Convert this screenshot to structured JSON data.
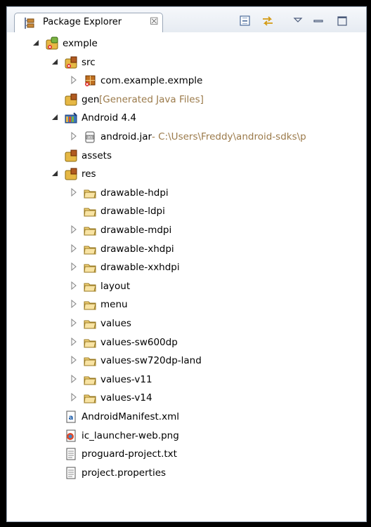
{
  "view": {
    "title": "Package Explorer",
    "close_glyph": "☒",
    "icons": {
      "view_icon": "package-explorer-icon",
      "collapse_all": "collapse-all-icon",
      "link_with_editor": "link-with-editor-icon",
      "view_menu": "view-menu-icon",
      "minimize": "minimize-icon",
      "maximize": "maximize-icon"
    }
  },
  "tree": [
    {
      "label": "exmple",
      "decoration": "",
      "depth": 0,
      "twisty": "expanded",
      "icon": "android-project"
    },
    {
      "label": "src",
      "decoration": "",
      "depth": 1,
      "twisty": "expanded",
      "icon": "source-folder-error"
    },
    {
      "label": "com.example.exmple",
      "decoration": "",
      "depth": 2,
      "twisty": "collapsed",
      "icon": "package-error"
    },
    {
      "label": "gen",
      "decoration": " [Generated Java Files]",
      "depth": 1,
      "twisty": "none",
      "icon": "source-folder"
    },
    {
      "label": "Android 4.4",
      "decoration": "",
      "depth": 1,
      "twisty": "expanded",
      "icon": "library"
    },
    {
      "label": "android.jar",
      "decoration": " - C:\\Users\\Freddy\\android-sdks\\p",
      "depth": 2,
      "twisty": "collapsed",
      "icon": "jar"
    },
    {
      "label": "assets",
      "decoration": "",
      "depth": 1,
      "twisty": "none",
      "icon": "source-folder"
    },
    {
      "label": "res",
      "decoration": "",
      "depth": 1,
      "twisty": "expanded",
      "icon": "source-folder"
    },
    {
      "label": "drawable-hdpi",
      "decoration": "",
      "depth": 2,
      "twisty": "collapsed",
      "icon": "folder"
    },
    {
      "label": "drawable-ldpi",
      "decoration": "",
      "depth": 2,
      "twisty": "none",
      "icon": "folder"
    },
    {
      "label": "drawable-mdpi",
      "decoration": "",
      "depth": 2,
      "twisty": "collapsed",
      "icon": "folder"
    },
    {
      "label": "drawable-xhdpi",
      "decoration": "",
      "depth": 2,
      "twisty": "collapsed",
      "icon": "folder"
    },
    {
      "label": "drawable-xxhdpi",
      "decoration": "",
      "depth": 2,
      "twisty": "collapsed",
      "icon": "folder"
    },
    {
      "label": "layout",
      "decoration": "",
      "depth": 2,
      "twisty": "collapsed",
      "icon": "folder"
    },
    {
      "label": "menu",
      "decoration": "",
      "depth": 2,
      "twisty": "collapsed",
      "icon": "folder"
    },
    {
      "label": "values",
      "decoration": "",
      "depth": 2,
      "twisty": "collapsed",
      "icon": "folder"
    },
    {
      "label": "values-sw600dp",
      "decoration": "",
      "depth": 2,
      "twisty": "collapsed",
      "icon": "folder"
    },
    {
      "label": "values-sw720dp-land",
      "decoration": "",
      "depth": 2,
      "twisty": "collapsed",
      "icon": "folder"
    },
    {
      "label": "values-v11",
      "decoration": "",
      "depth": 2,
      "twisty": "collapsed",
      "icon": "folder"
    },
    {
      "label": "values-v14",
      "decoration": "",
      "depth": 2,
      "twisty": "collapsed",
      "icon": "folder"
    },
    {
      "label": "AndroidManifest.xml",
      "decoration": "",
      "depth": 1,
      "twisty": "none",
      "icon": "xml-file"
    },
    {
      "label": "ic_launcher-web.png",
      "decoration": "",
      "depth": 1,
      "twisty": "none",
      "icon": "image-file"
    },
    {
      "label": "proguard-project.txt",
      "decoration": "",
      "depth": 1,
      "twisty": "none",
      "icon": "text-file"
    },
    {
      "label": "project.properties",
      "decoration": "",
      "depth": 1,
      "twisty": "none",
      "icon": "text-file"
    }
  ]
}
